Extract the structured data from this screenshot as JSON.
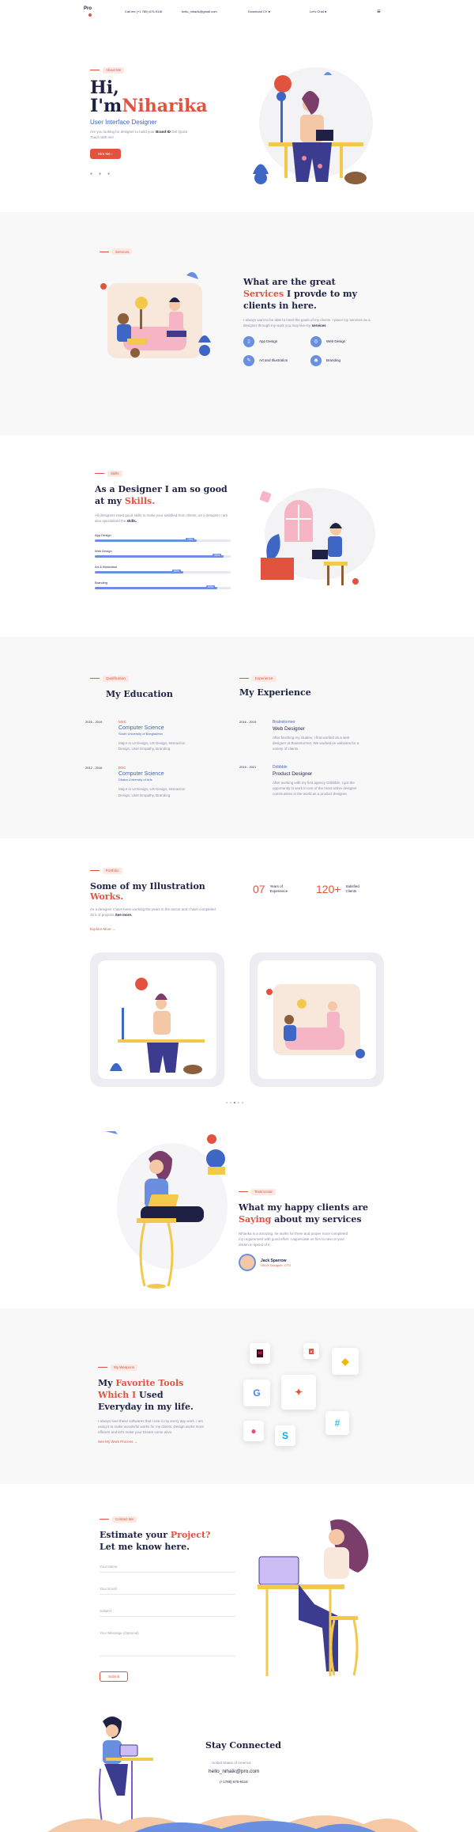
{
  "header": {
    "logo": "Pro",
    "phone": "Call me (+1 780) 675-9116",
    "email": "hello_niharik@gmail.com",
    "download": "Download CV",
    "chat": "Let's Chat"
  },
  "hero": {
    "tag": "About Me",
    "greeting": "Hi,",
    "iam": "I'm",
    "name": "Niharika",
    "role": "User Interface Designer",
    "text_a": "Are you looking for designer to build your",
    "text_brand": "Brand ID",
    "text_b": "Get Quick Touch with me!",
    "cta": "Hire Me"
  },
  "services": {
    "tag": "Services",
    "title_a": "What are the great",
    "title_accent": "Services",
    "title_b": "I provde to my clients in here.",
    "text_a": "I always want to be able to meet the goals of my clients. I place my services as a designer through my work you may like my",
    "text_bold": "services",
    "items": [
      "App Design",
      "Web Design",
      "Art and Illustration",
      "Branding"
    ]
  },
  "skills": {
    "tag": "Skills",
    "title_a": "As a Designer I am so good at my",
    "title_accent": "Skills.",
    "text_a": "All designers need good skills to make your satisfied from clients, as a designer I am also specialized the",
    "text_bold": "skills.",
    "items": [
      {
        "name": "App Design",
        "value": 75
      },
      {
        "name": "Web Design",
        "value": 95
      },
      {
        "name": "Art & Illustration",
        "value": 65
      },
      {
        "name": "Branding",
        "value": 90
      }
    ]
  },
  "education": {
    "tag": "Qualification",
    "title": "My Education",
    "items": [
      {
        "years": "2016 - 2019",
        "degree": "MSC",
        "field": "Computer Science",
        "school": "South University of Bangladesh",
        "desc": "Major in UI Design, UX Design, Interaction Design, User Empathy, Branding"
      },
      {
        "years": "2012 - 2016",
        "degree": "BSC",
        "field": "Computer Science",
        "school": "Dhaka University of Arts",
        "desc": "Major in UI Design, UX Design, Interaction Design, User Empathy, Branding"
      }
    ]
  },
  "experience": {
    "tag": "Experience",
    "title": "My Experience",
    "items": [
      {
        "years": "2016 - 2019",
        "company": "Brainstormer",
        "role": "Web Designer",
        "desc": "After finishing my studies, I first worked as a web designer at Brainstormer. We worked on websites for a variety of clients."
      },
      {
        "years": "2019 - 2021",
        "company": "Dribbble",
        "role": "Product Designer",
        "desc": "After working with my first agency Dribbble, I got the opportunity to work in one of the most active designer communities in the world as a product designer."
      }
    ]
  },
  "portfolio": {
    "tag": "Portfolio",
    "title_a": "Some of my Illustration",
    "title_accent": "Works.",
    "text_a": "As a designer I have been working the years in the sector and I have completed 25 k of projects",
    "text_bold": "See more.",
    "explore": "Explore More",
    "years_num": "07",
    "years_label_a": "Years of",
    "years_label_b": "Experience",
    "clients_num": "120+",
    "clients_label_a": "Satisfied",
    "clients_label_b": "Clients"
  },
  "testimonial": {
    "tag": "Testimonial",
    "title_a": "What my happy clients are",
    "title_accent": "Saying",
    "title_b": "about my services",
    "text": "Niharika is a amazing, he works for three and proper more completed my requirement with good effort. I appreciate on him to next or your dream in spend of it.",
    "name": "Jack Sparrow",
    "job": "UI/UX Designer, CTO"
  },
  "tools": {
    "tag": "My Weapons",
    "title_a": "My",
    "title_accent": "Favorite Tools Which I",
    "title_b": "Used Everyday in my life.",
    "text": "I always love these softwares that I use in my every day work. I am using it to make wonderful works for my clients. Design works more efficient and let's make your Dream come alive.",
    "link": "See My Work Process"
  },
  "contact": {
    "tag": "Contact Me",
    "title_a": "Estimate your",
    "title_accent": "Project?",
    "title_b": "Let me know here.",
    "name_ph": "Your Name",
    "email_ph": "Your Email",
    "subject_ph": "Subject",
    "message_ph": "Your Message (Optional)",
    "submit": "Submit"
  },
  "footer": {
    "title": "Stay Connected",
    "address": "United States of America",
    "email": "hello_nihaik@pro.com",
    "phone": "(+1788) 675-9116"
  }
}
